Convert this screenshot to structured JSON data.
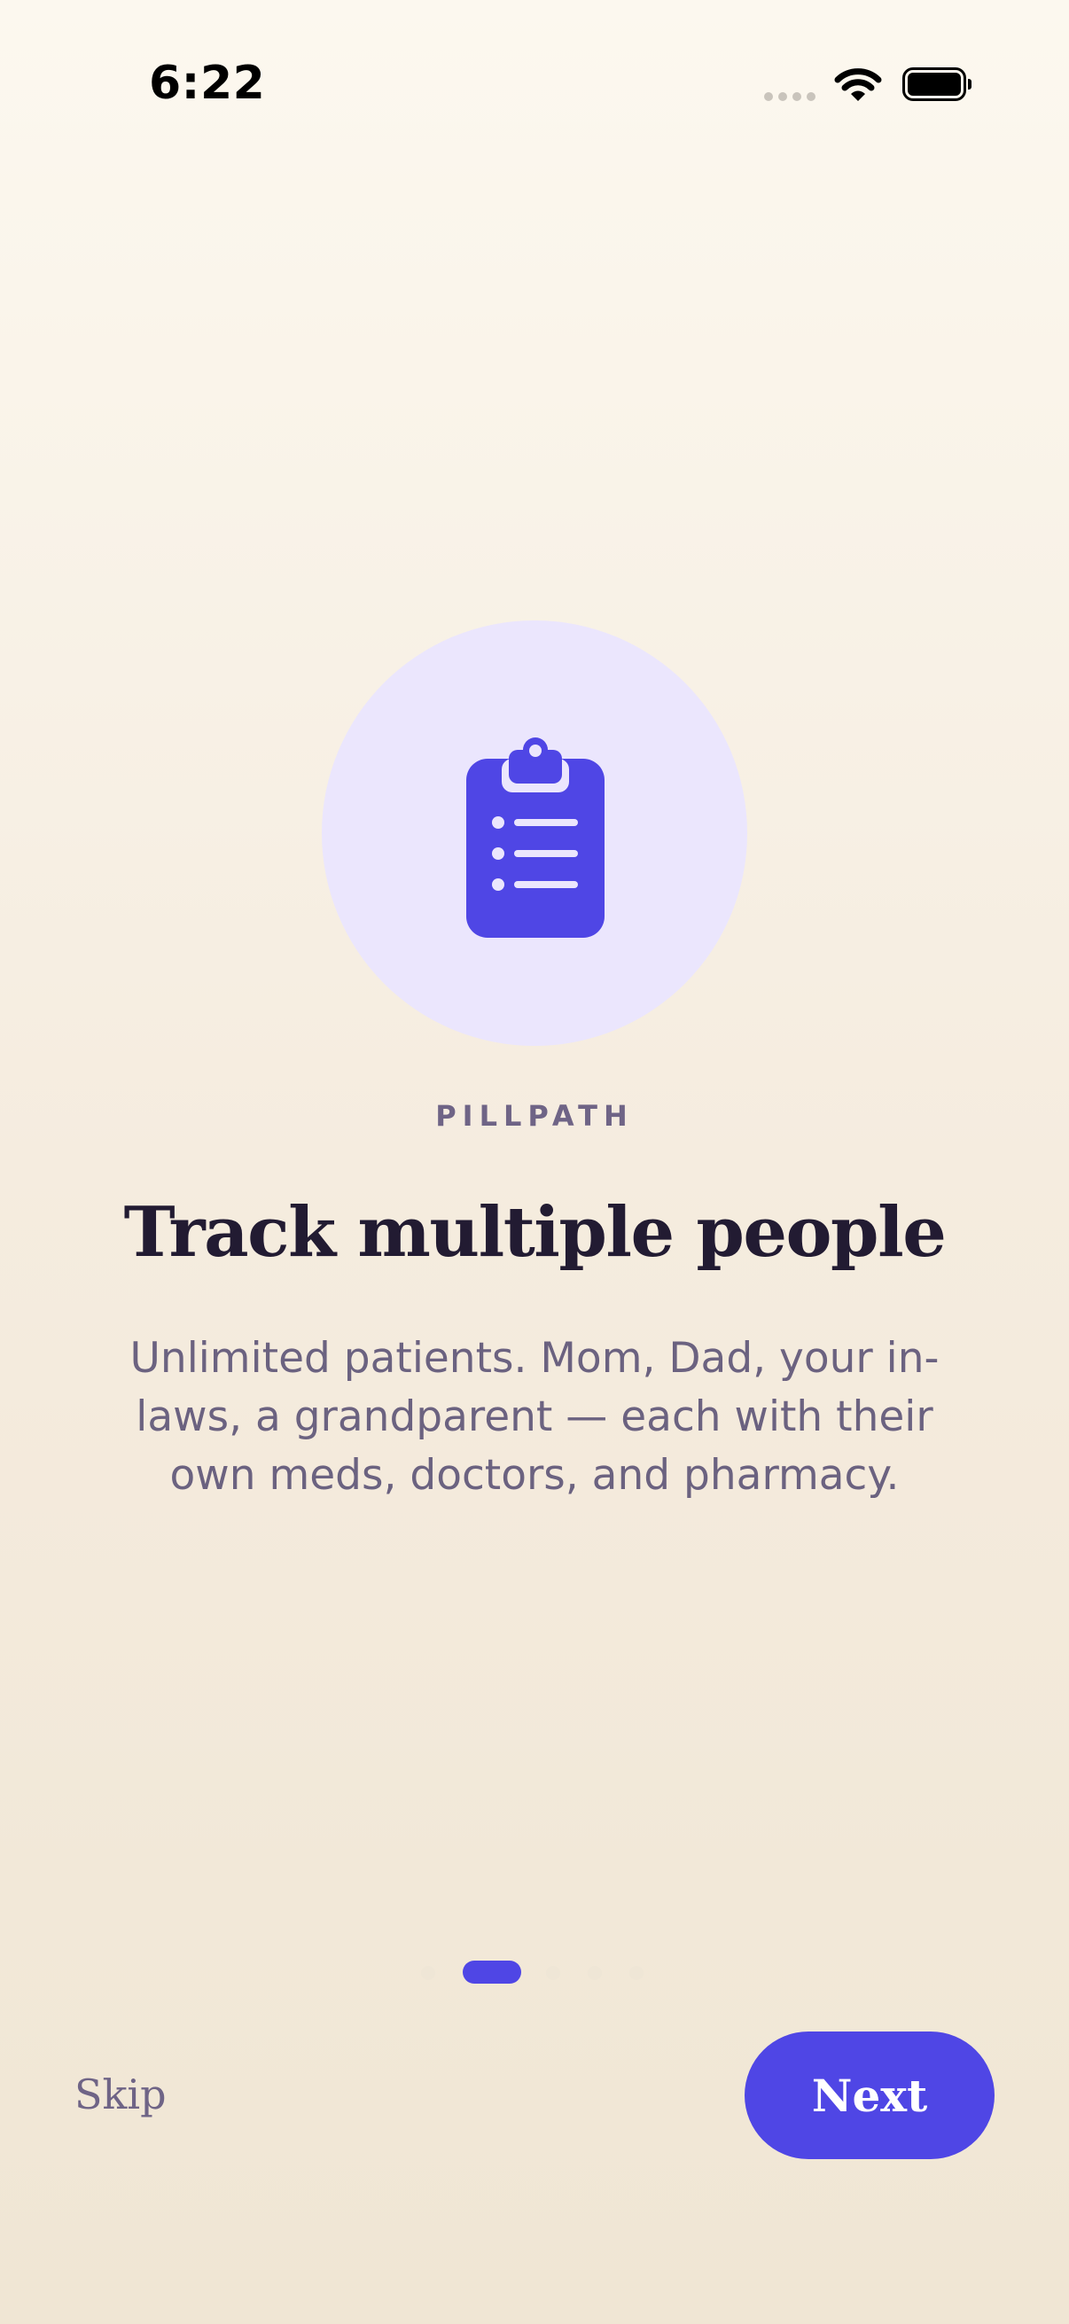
{
  "status_bar": {
    "time": "6:22",
    "icons": [
      "cellular-signal-icon",
      "wifi-icon",
      "battery-icon"
    ]
  },
  "hero": {
    "icon": "clipboard-list-icon",
    "circle_color": "#ebe6fd",
    "icon_color": "#4f46e5"
  },
  "content": {
    "brand": "PILLPATH",
    "headline": "Track multiple people",
    "body": "Unlimited patients. Mom, Dad, your in-laws, a grandparent — each with their own meds, doctors, and pharmacy."
  },
  "pager": {
    "total_pages": 6,
    "current_page": 2
  },
  "actions": {
    "skip_label": "Skip",
    "next_label": "Next"
  },
  "colors": {
    "accent": "#4f46e5",
    "headline": "#221b32",
    "muted_text": "#6b6280"
  }
}
